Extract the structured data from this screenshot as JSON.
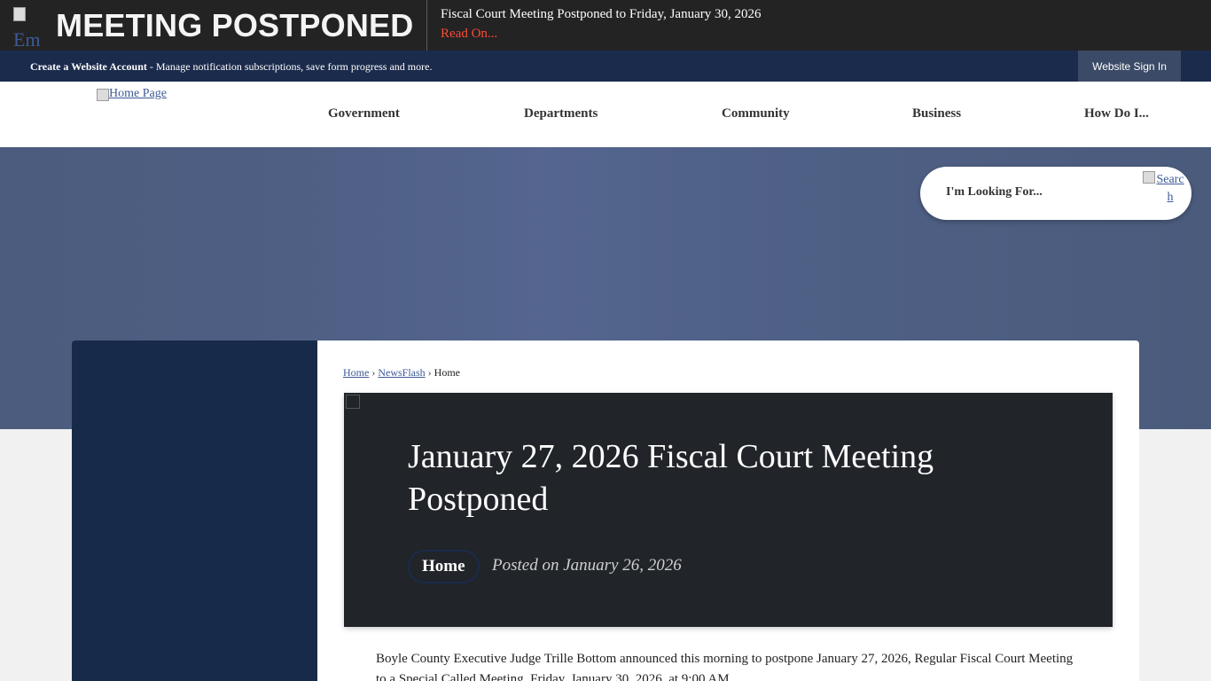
{
  "alert": {
    "icon_alt": "Em",
    "heading": "MEETING POSTPONED",
    "text": "Fiscal Court Meeting Postponed to Friday, January 30, 2026",
    "link": "Read On..."
  },
  "account_bar": {
    "create_label": "Create a Website Account",
    "description": " - Manage notification subscriptions, save form progress and more.",
    "signin_label": "Website Sign In"
  },
  "header": {
    "logo_alt": "Home Page",
    "nav": [
      "Government",
      "Departments",
      "Community",
      "Business",
      "How Do I..."
    ]
  },
  "search": {
    "placeholder": "I'm Looking For...",
    "button_alt": "Search"
  },
  "breadcrumb": {
    "items": [
      "Home",
      "NewsFlash",
      "Home"
    ],
    "separator": "›"
  },
  "article": {
    "title": "January 27, 2026 Fiscal Court Meeting Postponed",
    "category": "Home",
    "posted": "Posted on January 26, 2026",
    "body": "Boyle County Executive Judge Trille Bottom announced this morning to postpone January 27, 2026, Regular Fiscal Court Meeting to a Special Called Meeting, Friday, January 30, 2026, at 9:00 AM."
  },
  "colors": {
    "alert_bg": "#232323",
    "alert_link": "#ff4a35",
    "account_bar_bg": "#1b2b4c",
    "signin_bg": "#3b4a66",
    "banner": "#54658f",
    "side_panel": "#182a4a",
    "hero_bg": "#212429"
  }
}
